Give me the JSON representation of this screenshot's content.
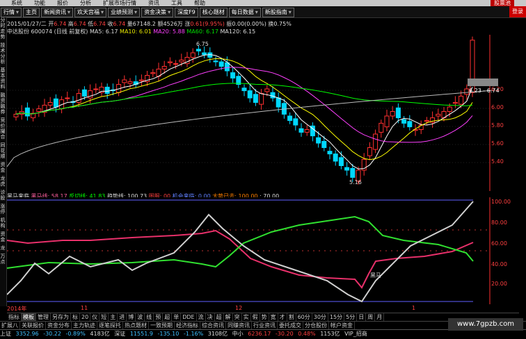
{
  "menubar": {
    "items": [
      "系统",
      "功能",
      "报价",
      "分析",
      "扩展市场行情",
      "资讯",
      "工具",
      "帮助"
    ],
    "badge": "股票池"
  },
  "toolbar": {
    "buttons": [
      {
        "label": "行情",
        "caret": true
      },
      {
        "label": "主页",
        "caret": false
      },
      {
        "label": "新闻资讯",
        "caret": true
      },
      {
        "label": "欢天宫福",
        "caret": true
      },
      {
        "label": "业绩预测",
        "caret": true
      },
      {
        "label": "资金决策",
        "caret": true
      },
      {
        "label": "深度F9",
        "caret": false
      },
      {
        "label": "核心题材",
        "caret": false
      },
      {
        "label": "每日数据",
        "caret": true
      },
      {
        "label": "新股指南",
        "caret": true
      }
    ],
    "right_label": "登录"
  },
  "sidebar": {
    "items": [
      "分时走势",
      "技术分析",
      "基本资料",
      "融资融券",
      "竞价撮合",
      "同花顺",
      "资金",
      "龙虎",
      "诊股",
      "涨停",
      "机构",
      "资金",
      "龙",
      "万点"
    ]
  },
  "stock_info": {
    "name": "中达股份",
    "code": "600074",
    "mode": "(日线 前复权)",
    "date": "2015/01/27/二",
    "open_label": "开",
    "open": "6.74",
    "high_label": "高",
    "high": "6.74",
    "low_label": "低",
    "low": "6.74",
    "close_label": "收",
    "close": "6.74",
    "vol_label": "量",
    "vol": "67148.2",
    "amount_label": "额",
    "amount": "4526万",
    "change_label": "涨",
    "change": "0.61",
    "change_pct": "(9.95%)",
    "amp_label": "振",
    "amp": "0.00",
    "amp_pct": "(0.00%)",
    "turnover_label": "换",
    "turnover": "0.75%"
  },
  "ma": {
    "ma5": "MA5: 6.17",
    "ma10": "MA10: 6.01",
    "ma20": "MA20: 5.88",
    "ma60": "MA60: 6.17",
    "ma120": "MA120: 6.15"
  },
  "price_axis": [
    "6.20",
    "6.00",
    "5.80",
    "5.60",
    "5.40"
  ],
  "annotations": {
    "high_marker": "6.75",
    "low_marker": "5.16",
    "range_label": "6.23 - 6.74",
    "horse_label": "黑马"
  },
  "indicator": {
    "name": "黑马来临",
    "line1": "黑马线: 58.17",
    "line2": "反切线: 41.83",
    "line3": "趋势线: 100.73",
    "line4": "图服: 00",
    "line5": "机会来临: 0.00",
    "line6": "大势已去: 100.00",
    "line7": ": 70.00"
  },
  "ind_axis": [
    "100.00",
    "80.00",
    "60.00",
    "40.00",
    "20.00"
  ],
  "xaxis": {
    "year": "2014年",
    "m11": "11",
    "m12": "12",
    "m1": "1"
  },
  "tabs_row1": [
    "指标",
    "模板",
    "管理",
    "另存为",
    "标",
    "20",
    "仪",
    "短",
    "主",
    "进",
    "博",
    "波",
    "线",
    "预",
    "超",
    "单",
    "DDE",
    "流",
    "决",
    "超",
    "解",
    "突",
    "实",
    "假",
    "势",
    "宽",
    "才",
    "割",
    "60分",
    "30分",
    "15分",
    "5分",
    "日",
    "周",
    "月"
  ],
  "tabs_row1_active": 1,
  "tabs_row2": [
    "扩展八",
    "关联报价",
    "资金分布",
    "主力轨迹",
    "逐笔探托",
    "热点题材",
    "一致预期",
    "经济指标",
    "综合资讯",
    "同赚资讯",
    "行业资讯",
    "委托成交",
    "分仓股份",
    "帐户资金"
  ],
  "status": {
    "sh_label": "上证",
    "sh_val": "3352.96",
    "sh_chg": "-30.22",
    "sh_pct": "-0.89%",
    "sh_amt": "4183亿",
    "sz_label": "深证",
    "sz_val": "11551.9",
    "sz_chg": "-135.10",
    "sz_pct": "-1.16%",
    "sz_amt": "3108亿",
    "zx_label": "中小",
    "zx_val": "6236.17",
    "zx_chg": "-30.20",
    "zx_pct": "0.48%",
    "zx_amt": "1153亿",
    "vip": "VIP_招商"
  },
  "watermark": "www.7gpzb.com",
  "colors": {
    "up": "#ff3030",
    "down": "#00d8ff",
    "ma5": "#ffffff",
    "ma10": "#ffff00",
    "ma20": "#ff40ff",
    "ma60": "#00ff00",
    "ma120": "#ffffff"
  }
}
